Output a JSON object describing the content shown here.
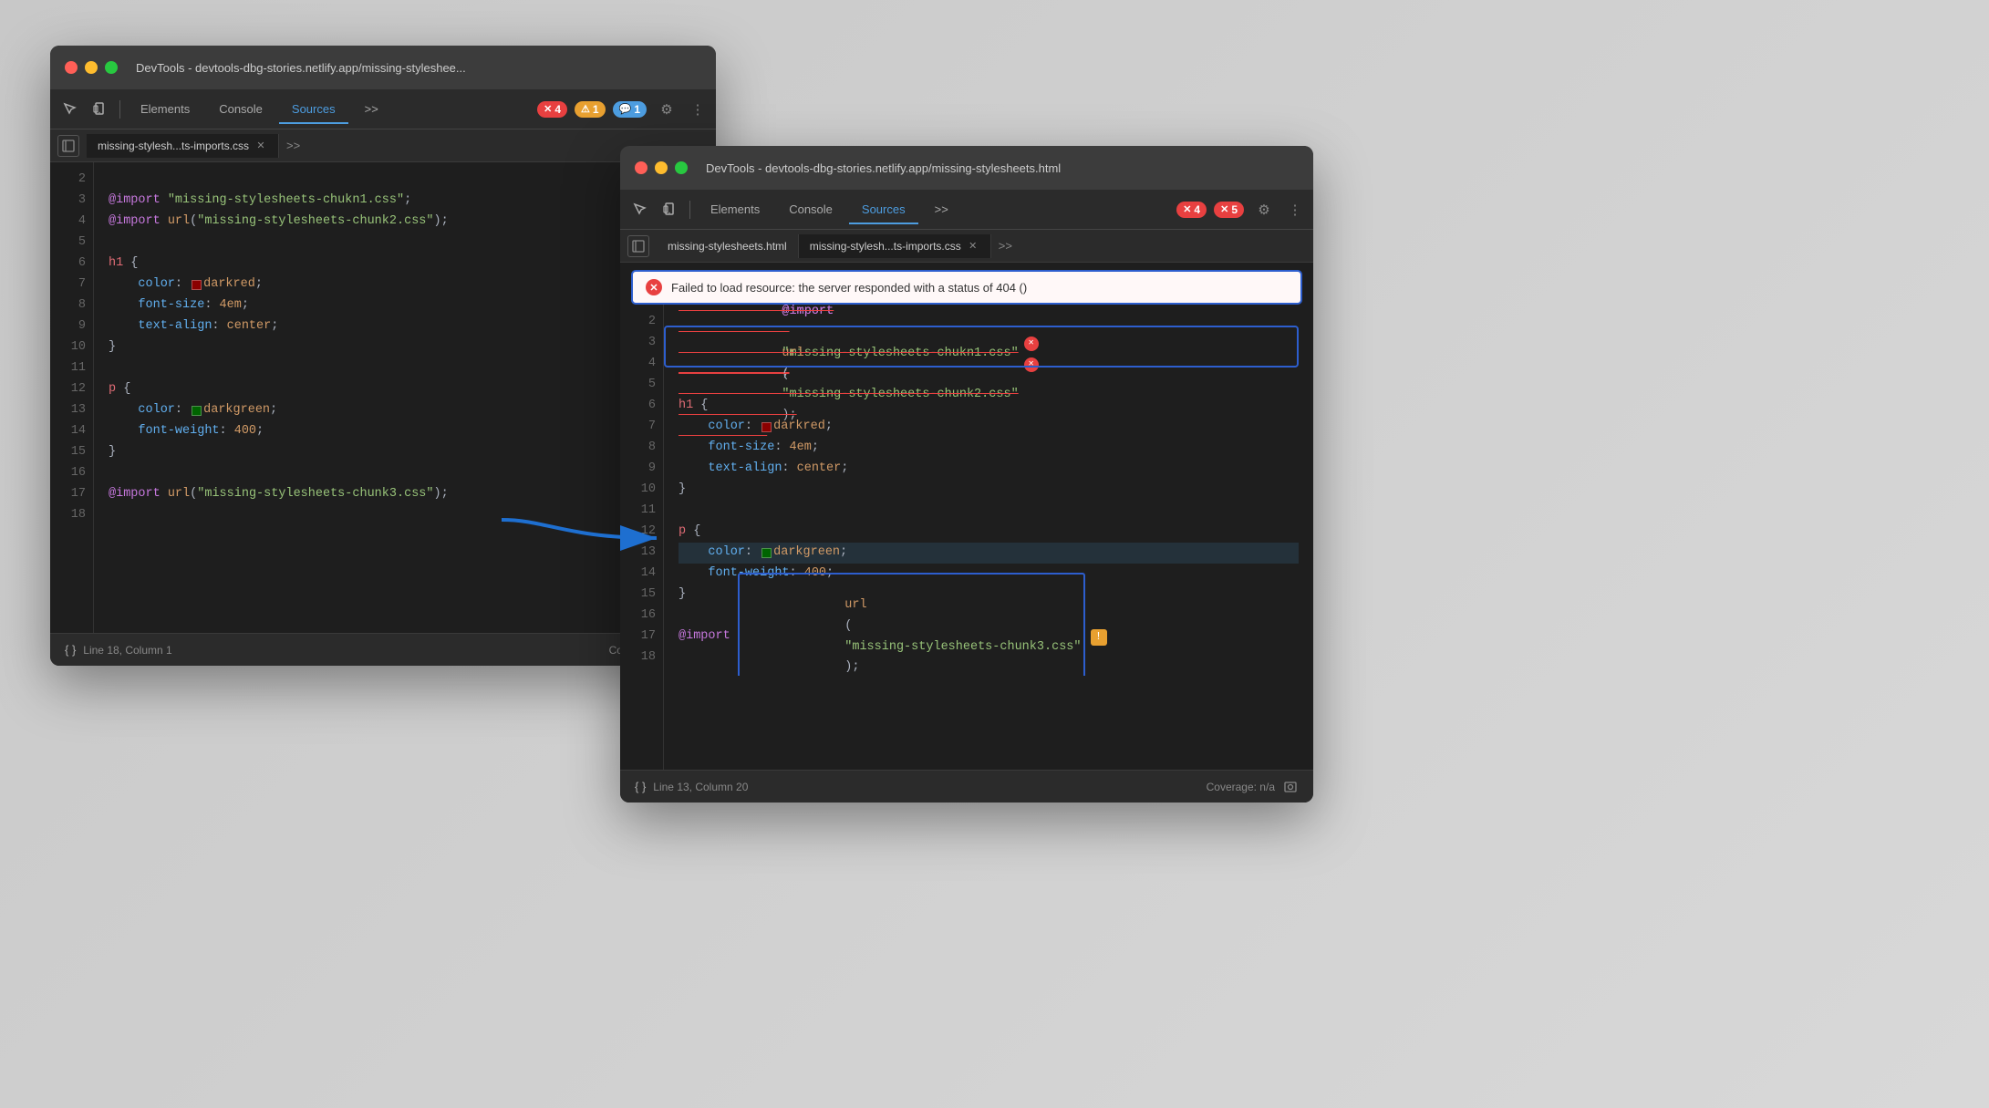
{
  "window1": {
    "titlebar": {
      "title": "DevTools - devtools-dbg-stories.netlify.app/missing-styleshee..."
    },
    "toolbar": {
      "tabs": [
        "Elements",
        "Console",
        "Sources"
      ],
      "active_tab": "Sources",
      "badges": [
        {
          "type": "red",
          "icon": "✕",
          "count": "4"
        },
        {
          "type": "yellow",
          "icon": "⚠",
          "count": "1"
        },
        {
          "type": "blue",
          "icon": "💬",
          "count": "1"
        }
      ]
    },
    "file_tabs": {
      "tabs": [
        "missing-stylesh...ts-imports.css"
      ],
      "active": "missing-stylesh...ts-imports.css"
    },
    "code": {
      "lines": [
        {
          "num": "2",
          "content": ""
        },
        {
          "num": "3",
          "content": "@import \"missing-stylesheets-chukn1.css\";"
        },
        {
          "num": "4",
          "content": "@import url(\"missing-stylesheets-chunk2.css\");"
        },
        {
          "num": "5",
          "content": ""
        },
        {
          "num": "6",
          "content": "h1 {"
        },
        {
          "num": "7",
          "content": "    color:  darkred;"
        },
        {
          "num": "8",
          "content": "    font-size: 4em;"
        },
        {
          "num": "9",
          "content": "    text-align: center;"
        },
        {
          "num": "10",
          "content": "}"
        },
        {
          "num": "11",
          "content": ""
        },
        {
          "num": "12",
          "content": "p {"
        },
        {
          "num": "13",
          "content": "    color:  darkgreen;"
        },
        {
          "num": "14",
          "content": "    font-weight: 400;"
        },
        {
          "num": "15",
          "content": "}"
        },
        {
          "num": "16",
          "content": ""
        },
        {
          "num": "17",
          "content": "@import url(\"missing-stylesheets-chunk3.css\");"
        },
        {
          "num": "18",
          "content": ""
        }
      ]
    },
    "status_bar": {
      "line": "Line 18, Column 1",
      "coverage": "Coverage: n/a"
    }
  },
  "window2": {
    "titlebar": {
      "title": "DevTools - devtools-dbg-stories.netlify.app/missing-stylesheets.html"
    },
    "toolbar": {
      "tabs": [
        "Elements",
        "Console",
        "Sources"
      ],
      "active_tab": "Sources",
      "badges": [
        {
          "type": "red",
          "icon": "✕",
          "count": "4"
        },
        {
          "type": "red",
          "icon": "✕",
          "count": "5"
        }
      ]
    },
    "file_tabs": {
      "tabs": [
        "missing-stylesheets.html",
        "missing-stylesh...ts-imports.css"
      ],
      "active": "missing-stylesh...ts-imports.css"
    },
    "error_tooltip": {
      "text": "Failed to load resource: the server responded with a status of 404 ()"
    },
    "code": {
      "lines": [
        {
          "num": "2",
          "content": ""
        },
        {
          "num": "3",
          "content": "@import \"missing-stylesheets-chukn1.css\"; ✕",
          "error": true
        },
        {
          "num": "4",
          "content": "@import url(\"missing-stylesheets-chunk2.css\"); ✕",
          "error": true
        },
        {
          "num": "5",
          "content": ""
        },
        {
          "num": "6",
          "content": "h1 {"
        },
        {
          "num": "7",
          "content": "    color:  darkred;"
        },
        {
          "num": "8",
          "content": "    font-size: 4em;"
        },
        {
          "num": "9",
          "content": "    text-align: center;"
        },
        {
          "num": "10",
          "content": "}"
        },
        {
          "num": "11",
          "content": ""
        },
        {
          "num": "12",
          "content": "p {"
        },
        {
          "num": "13",
          "content": "    color:  darkgreen;"
        },
        {
          "num": "14",
          "content": "    font-weight: 400;"
        },
        {
          "num": "15",
          "content": "}"
        },
        {
          "num": "16",
          "content": ""
        },
        {
          "num": "17",
          "content": "@import url(\"missing-stylesheets-chunk3.css\"); ⚠",
          "warning": true
        },
        {
          "num": "18",
          "content": ""
        }
      ]
    },
    "status_bar": {
      "line": "Line 13, Column 20",
      "coverage": "Coverage: n/a"
    }
  },
  "icons": {
    "inspect": "⬚",
    "device": "📱",
    "more": "≫",
    "gear": "⚙",
    "ellipsis": "⋮",
    "sidebar": "▣",
    "close": "✕",
    "curly": "{ }"
  },
  "colors": {
    "accent_blue": "#4d9de0",
    "error_red": "#e84040",
    "warning_yellow": "#e8a030",
    "darkred": "#8b0000",
    "darkgreen": "#006400",
    "outline_blue": "#2d5ece"
  }
}
